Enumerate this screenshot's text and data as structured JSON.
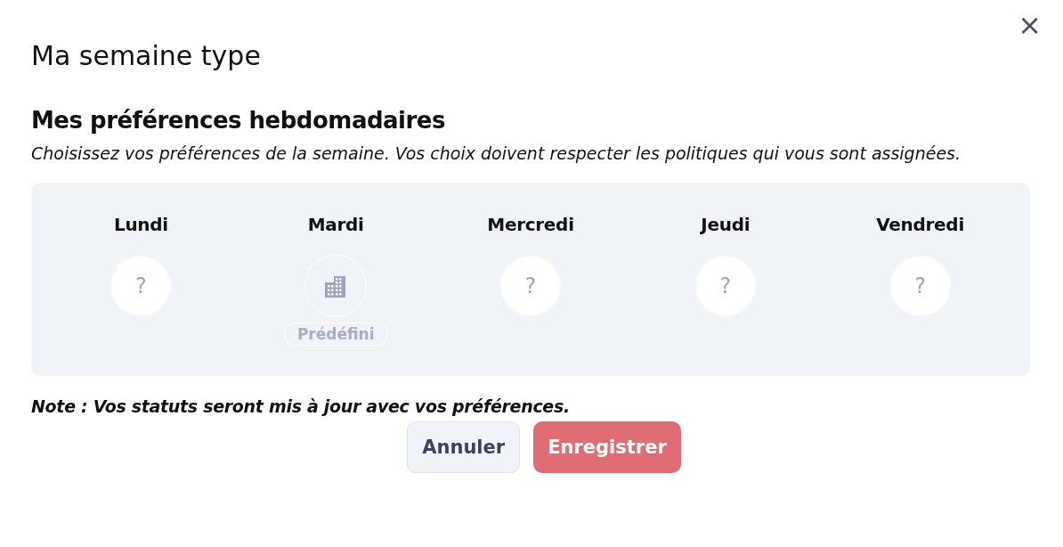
{
  "dialog": {
    "title": "Ma semaine type",
    "close": "×"
  },
  "section": {
    "heading": "Mes préférences hebdomadaires",
    "description": "Choisissez vos préférences de la semaine. Vos choix doivent respecter les politiques qui vous sont assignées."
  },
  "days": [
    {
      "name": "Lundi",
      "kind": "unknown",
      "icon": "?"
    },
    {
      "name": "Mardi",
      "kind": "office",
      "badge": "Prédéfini"
    },
    {
      "name": "Mercredi",
      "kind": "unknown",
      "icon": "?"
    },
    {
      "name": "Jeudi",
      "kind": "unknown",
      "icon": "?"
    },
    {
      "name": "Vendredi",
      "kind": "unknown",
      "icon": "?"
    }
  ],
  "note": "Note : Vos statuts seront mis à jour avec vos préférences.",
  "buttons": [
    {
      "label": "Annuler",
      "kind": "secondary"
    },
    {
      "label": "Enregistrer",
      "kind": "primary"
    }
  ]
}
